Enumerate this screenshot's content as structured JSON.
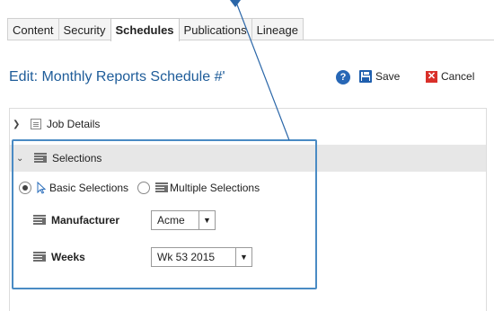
{
  "tabs": [
    {
      "label": "Content"
    },
    {
      "label": "Security"
    },
    {
      "label": "Schedules"
    },
    {
      "label": "Publications"
    },
    {
      "label": "Lineage"
    }
  ],
  "header": {
    "title": "Edit: Monthly Reports Schedule #'",
    "save_label": "Save",
    "cancel_label": "Cancel"
  },
  "sections": {
    "job_details": "Job Details",
    "selections": "Selections"
  },
  "selection_mode": {
    "basic": "Basic Selections",
    "multiple": "Multiple Selections",
    "selected": "basic"
  },
  "fields": {
    "manufacturer": {
      "label": "Manufacturer",
      "value": "Acme"
    },
    "weeks": {
      "label": "Weeks",
      "value": "Wk 53 2015"
    }
  },
  "colors": {
    "title": "#1e5c99",
    "highlight": "#4a8bc4",
    "cancel": "#d9302a",
    "save": "#1f5fae"
  }
}
